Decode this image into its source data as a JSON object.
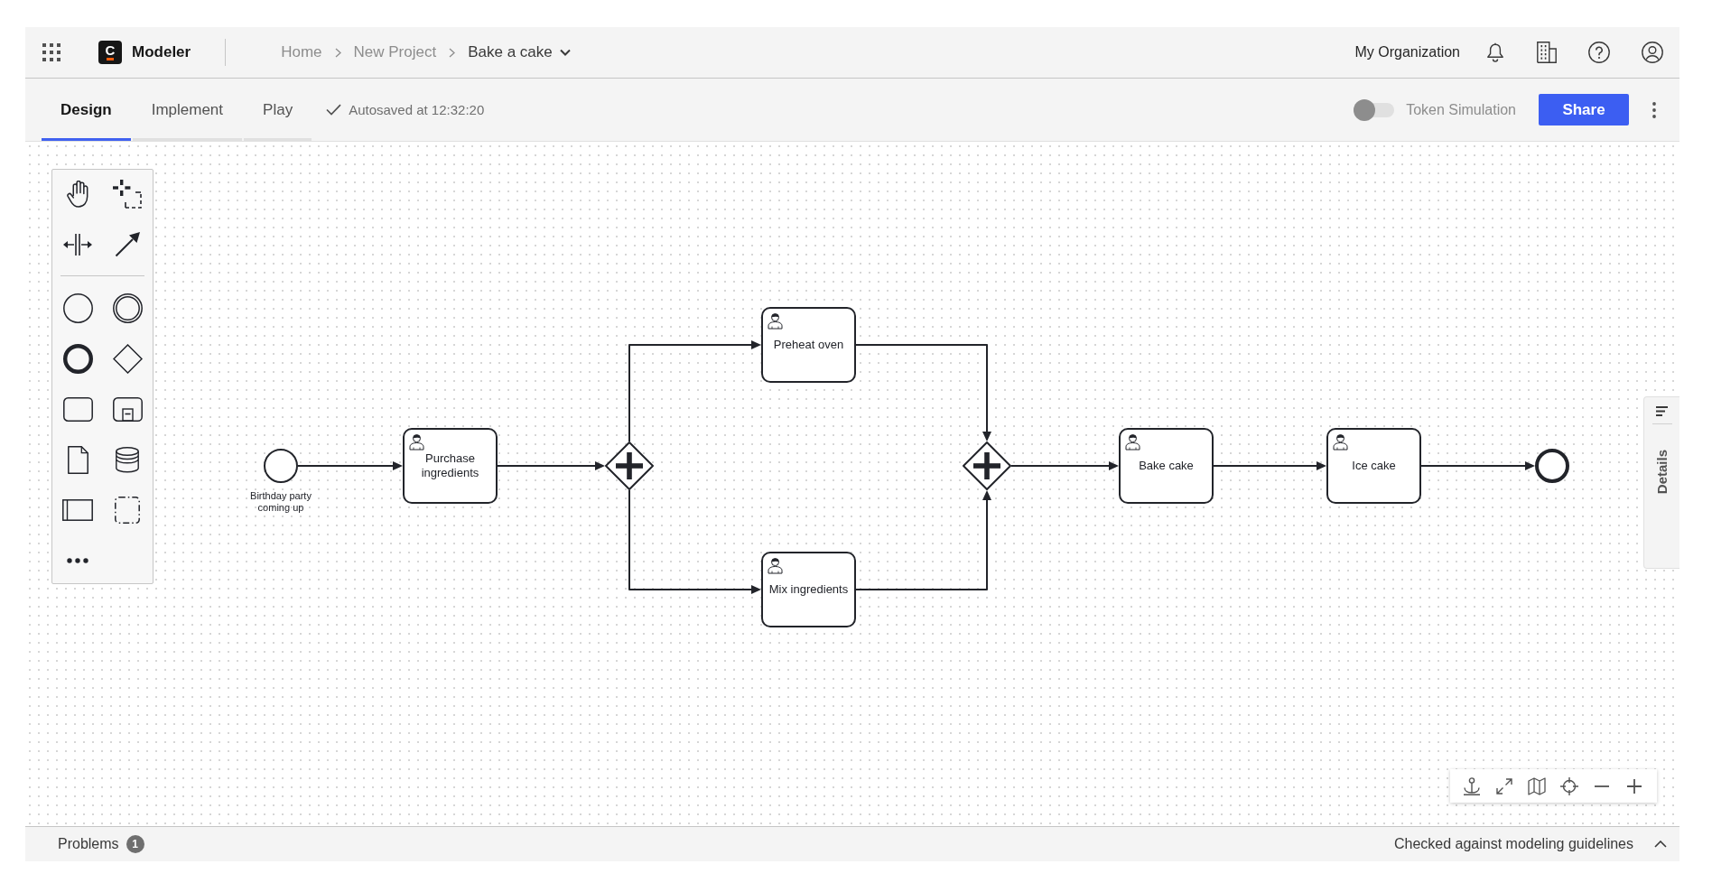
{
  "header": {
    "logo_text": "C",
    "app_name": "Modeler",
    "breadcrumbs": [
      {
        "label": "Home",
        "current": false
      },
      {
        "label": "New Project",
        "current": false
      },
      {
        "label": "Bake a cake",
        "current": true
      }
    ],
    "organization": "My Organization"
  },
  "toolbar": {
    "tabs": [
      {
        "label": "Design",
        "selected": true
      },
      {
        "label": "Implement",
        "selected": false
      },
      {
        "label": "Play",
        "selected": false
      }
    ],
    "autosave_status": "Autosaved at 12:32:20",
    "token_simulation": {
      "label": "Token Simulation",
      "on": false
    },
    "share_button": "Share"
  },
  "diagram": {
    "nodes": [
      {
        "kind": "start_event",
        "label": "Birthday party coming up"
      },
      {
        "kind": "user_task",
        "label": "Purchase ingredients"
      },
      {
        "kind": "parallel_gateway"
      },
      {
        "kind": "user_task",
        "label": "Preheat oven"
      },
      {
        "kind": "user_task",
        "label": "Mix ingredients"
      },
      {
        "kind": "parallel_gateway"
      },
      {
        "kind": "user_task",
        "label": "Bake cake"
      },
      {
        "kind": "user_task",
        "label": "Ice cake"
      },
      {
        "kind": "end_event"
      }
    ]
  },
  "details_panel": {
    "label": "Details"
  },
  "footer": {
    "problems_label": "Problems",
    "problems_count": "1",
    "lint_status": "Checked against modeling guidelines"
  }
}
